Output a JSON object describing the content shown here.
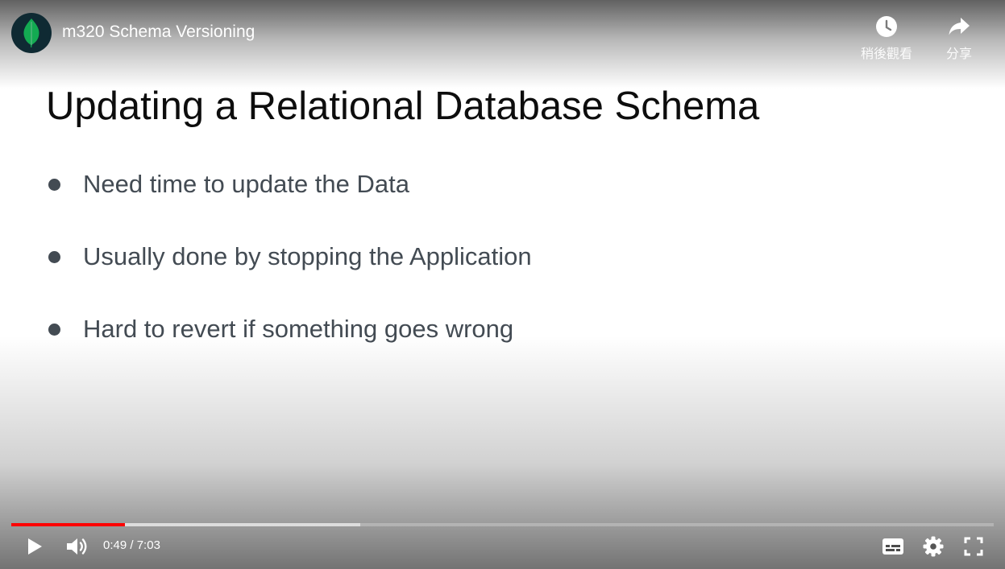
{
  "video": {
    "title": "m320 Schema Versioning",
    "channel_logo": "mongodb-leaf-icon"
  },
  "top_actions": {
    "watch_later_label": "稍後觀看",
    "watch_later_icon": "clock-icon",
    "share_label": "分享",
    "share_icon": "share-arrow-icon"
  },
  "slide": {
    "title": "Updating a Relational Database Schema",
    "bullets": [
      "Need time to update the Data",
      "Usually done by stopping the Application",
      "Hard to revert if something goes wrong"
    ]
  },
  "player": {
    "current_time": "0:49",
    "duration": "7:03",
    "time_separator": " / ",
    "played_fraction": 0.116,
    "buffered_fraction": 0.355,
    "accent_color": "#ff0000",
    "controls": {
      "play_icon": "play-icon",
      "volume_icon": "volume-icon",
      "subtitles_icon": "subtitles-icon",
      "settings_icon": "gear-icon",
      "fullscreen_icon": "fullscreen-icon"
    }
  }
}
